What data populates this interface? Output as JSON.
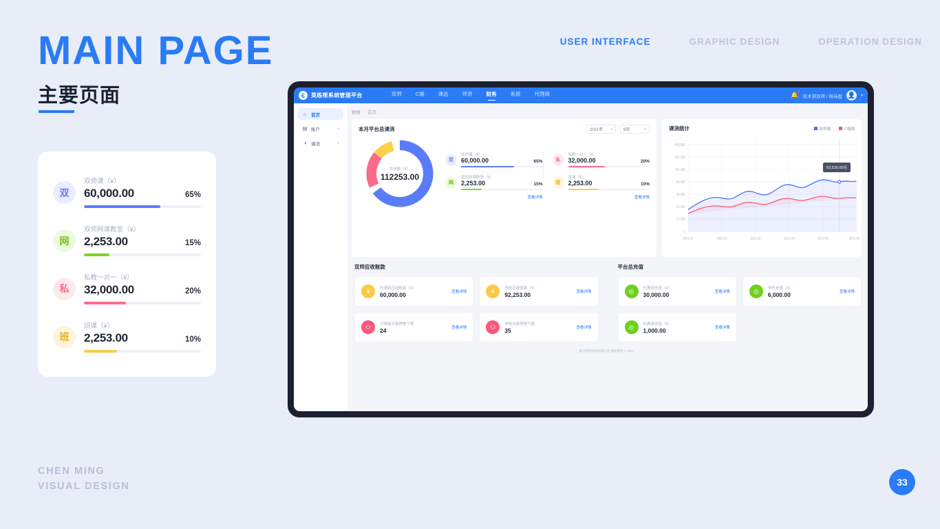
{
  "slide": {
    "title": "MAIN PAGE",
    "subtitle": "主要页面",
    "page_number": "33",
    "credit_line1": "CHEN MING",
    "credit_line2": "VISUAL DESIGN",
    "nav": [
      {
        "label": "USER INTERFACE",
        "active": true
      },
      {
        "label": "GRAPHIC DESIGN",
        "active": false
      },
      {
        "label": "OPERATION DESIGN",
        "active": false
      }
    ]
  },
  "metric_card": {
    "items": [
      {
        "badge": "双",
        "label": "双师课（¥）",
        "value": "60,000.00",
        "pct": "65%",
        "pct_num": 65,
        "color": "#5b7cfa",
        "bg": "#e9edfd"
      },
      {
        "badge": "网",
        "label": "双师网课教室（¥）",
        "value": "2,253.00",
        "pct": "15%",
        "pct_num": 15,
        "color": "#7ed321",
        "bg": "#eef9df"
      },
      {
        "badge": "私",
        "label": "私教一对一（¥）",
        "value": "32,000.00",
        "pct": "20%",
        "pct_num": 35,
        "color": "#fa6b87",
        "bg": "#fdeaef"
      },
      {
        "badge": "班",
        "label": "班课（¥）",
        "value": "2,253.00",
        "pct": "10%",
        "pct_num": 28,
        "color": "#f7cd4c",
        "bg": "#fdf4dc"
      }
    ]
  },
  "app": {
    "brand": "英练帮系统管理平台",
    "brand_logo": "€",
    "nav": [
      {
        "label": "双师",
        "active": false
      },
      {
        "label": "C端",
        "active": false
      },
      {
        "label": "课品",
        "active": false
      },
      {
        "label": "师资",
        "active": false
      },
      {
        "label": "财务",
        "active": true
      },
      {
        "label": "系统",
        "active": false
      },
      {
        "label": "代理商",
        "active": false
      }
    ],
    "user": "技术部双项 / 杨诗盈",
    "sidebar": [
      {
        "label": "首页",
        "icon": "⌂",
        "active": true,
        "caret": false
      },
      {
        "label": "账户",
        "icon": "▤",
        "active": false,
        "caret": true
      },
      {
        "label": "课消",
        "icon": "◑",
        "active": false,
        "caret": true
      }
    ],
    "breadcrumb": {
      "root": "财务",
      "sep": "›",
      "current": "首页"
    },
    "footer": "武汉英练科技有限公司 版权所有 © 2021"
  },
  "consume_panel": {
    "title": "本月平台总课消",
    "year_select": "2021年",
    "month_select": "6月",
    "donut_label": "总金额（¥）",
    "donut_value": "112253.00",
    "view_detail": "查看详情",
    "items": [
      {
        "badge": "双",
        "label": "双师课（¥）",
        "value": "60,000.00",
        "pct": "65%",
        "pct_num": 65,
        "color": "#5b7cfa",
        "bg": "#e9edfd"
      },
      {
        "badge": "私",
        "label": "私教一对一（¥）",
        "value": "32,000.00",
        "pct": "20%",
        "pct_num": 45,
        "color": "#fa6b87",
        "bg": "#fdeaef"
      },
      {
        "badge": "网",
        "label": "双师网课教室（¥）",
        "value": "2,253.00",
        "pct": "15%",
        "pct_num": 25,
        "color": "#7ed321",
        "bg": "#eef9df"
      },
      {
        "badge": "班",
        "label": "班课（¥）",
        "value": "2,253.00",
        "pct": "10%",
        "pct_num": 38,
        "color": "#f7cd4c",
        "bg": "#fdf4dc"
      }
    ]
  },
  "chart_data": {
    "type": "line",
    "title": "课消统计",
    "tooltip": "62,530.00元",
    "legend": [
      {
        "name": "双师课",
        "color": "#4a6cf7"
      },
      {
        "name": "C端课",
        "color": "#f9577a"
      }
    ],
    "x": [
      "2021-01",
      "2021-02",
      "2021-03",
      "2021-04",
      "2021-05",
      "2021-06"
    ],
    "yticks": [
      "640,000",
      "320,000",
      "160,000",
      "80,000",
      "40,000",
      "20,000",
      "10,000",
      "0"
    ],
    "ylim": [
      0,
      640000
    ],
    "xlabel": "",
    "ylabel": "",
    "grid": true,
    "legend_position": "top-right",
    "series": [
      {
        "name": "双师课",
        "color": "#4a6cf7",
        "values": [
          22000,
          31000,
          38000,
          36000,
          44000,
          41000,
          52000,
          58000,
          55000,
          62530,
          60000,
          57000
        ]
      },
      {
        "name": "C端课",
        "color": "#f9577a",
        "values": [
          19000,
          24000,
          26000,
          25000,
          30000,
          28000,
          33000,
          36000,
          34000,
          39000,
          41000,
          38000
        ]
      }
    ]
  },
  "receivables": {
    "title": "双师应收账款",
    "view_detail": "查看详情",
    "cards": [
      {
        "icon": "¥",
        "icon_color": "#fcc947",
        "label": "代理商应收账款（¥）",
        "value": "60,000.00"
      },
      {
        "icon": "¥",
        "icon_color": "#fcc947",
        "label": "学校应收账款（¥）",
        "value": "92,253.00"
      },
      {
        "icon": "⚇",
        "icon_color": "#f9577a",
        "label": "代理商欠费预警个数",
        "value": "24"
      },
      {
        "icon": "⚇",
        "icon_color": "#f9577a",
        "label": "学校欠费预警个数",
        "value": "35"
      }
    ]
  },
  "recharge": {
    "title": "平台总充值",
    "view_detail": "查看详情",
    "cards": [
      {
        "icon": "◎",
        "icon_color": "#6fd01e",
        "label": "代理商充值（¥）",
        "value": "30,000.00"
      },
      {
        "icon": "◎",
        "icon_color": "#6fd01e",
        "label": "学校充值（¥）",
        "value": "6,000.00"
      },
      {
        "icon": "◎",
        "icon_color": "#6fd01e",
        "label": "私教课充值（¥）",
        "value": "1,000.00"
      }
    ]
  }
}
